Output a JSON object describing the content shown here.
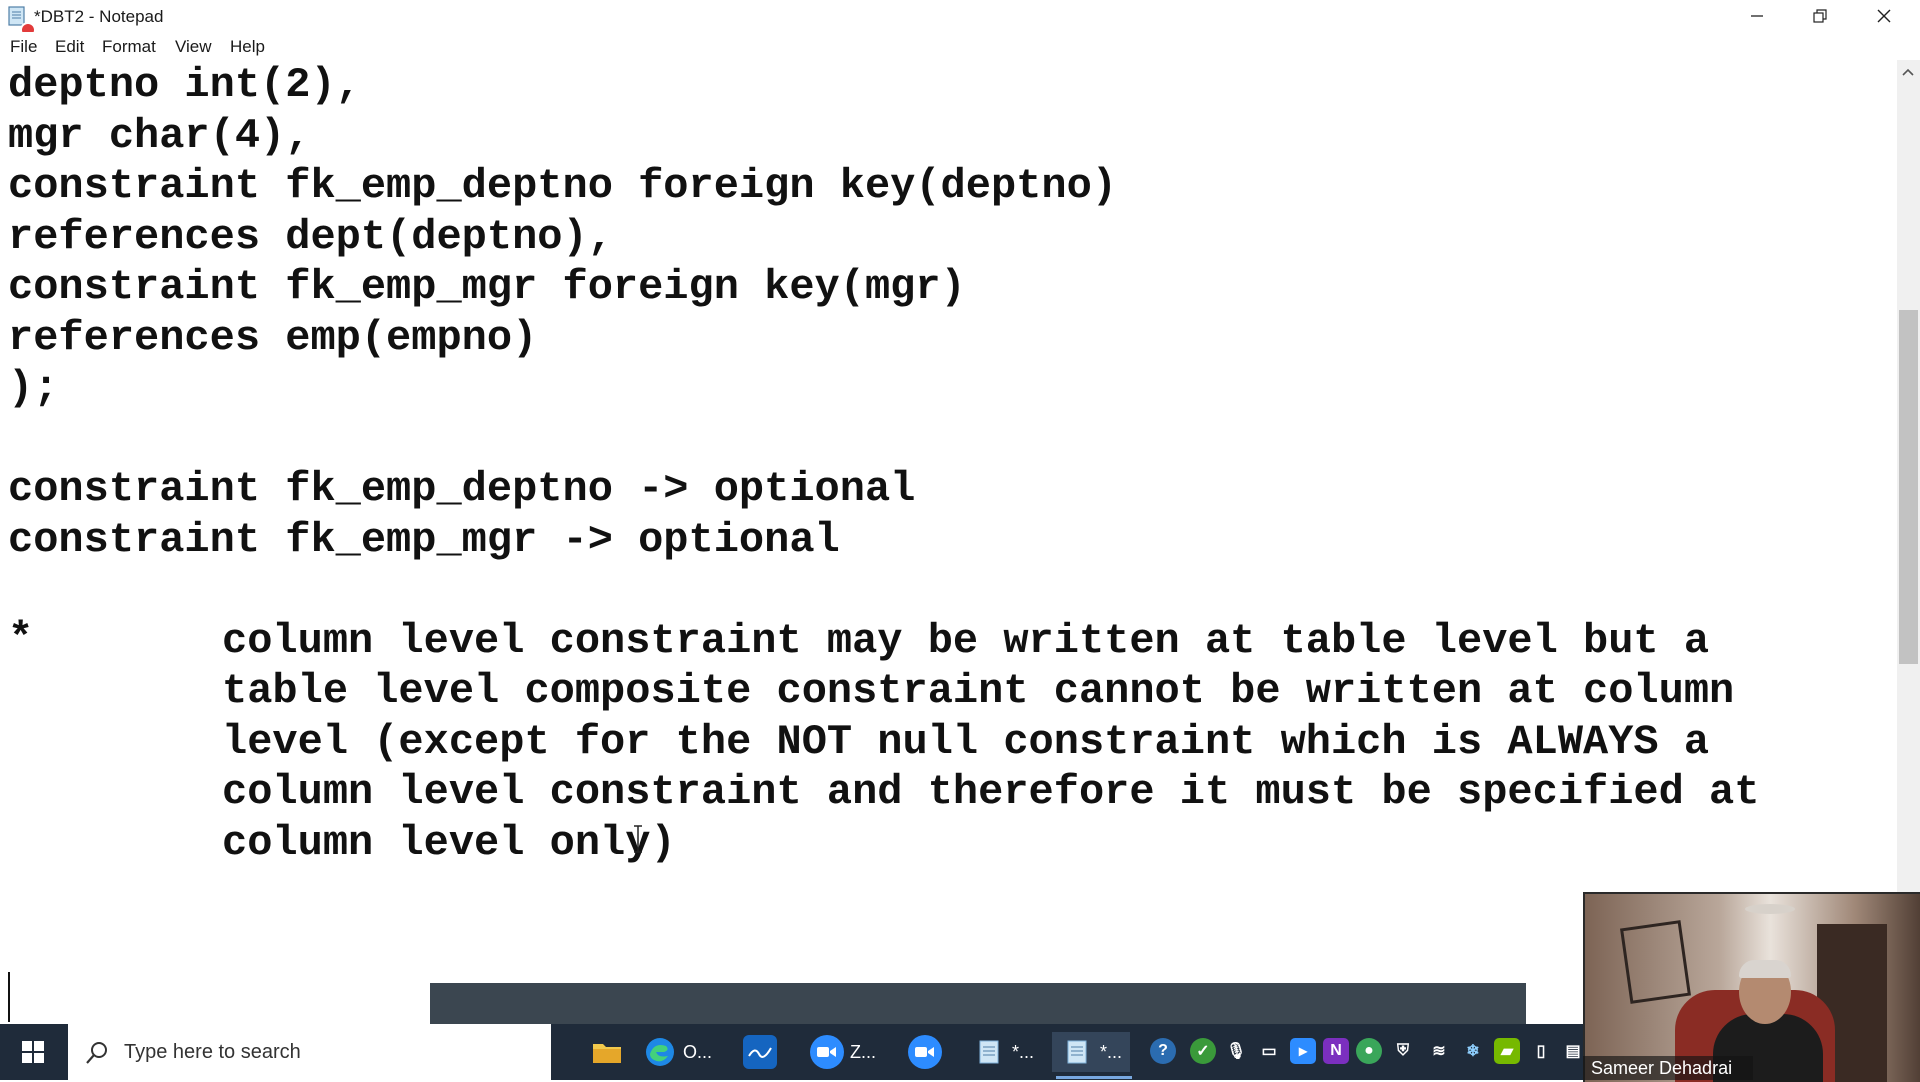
{
  "window": {
    "title": "*DBT2 - Notepad",
    "controls": [
      "minimize",
      "restore",
      "close"
    ]
  },
  "menu": [
    "File",
    "Edit",
    "Format",
    "View",
    "Help"
  ],
  "editor": {
    "lines": [
      "deptno int(2),",
      "mgr char(4),",
      "constraint fk_emp_deptno foreign key(deptno)",
      "references dept(deptno),",
      "constraint fk_emp_mgr foreign key(mgr)",
      "references emp(empno)",
      ");",
      "",
      "constraint fk_emp_deptno -> optional",
      "constraint fk_emp_mgr -> optional",
      "",
      "column level constraint may be written at table level but a",
      "table level composite constraint cannot be written at column",
      "level (except for the NOT null constraint which is ALWAYS a",
      "column level constraint and therefore it must be specified at",
      "column level only)"
    ],
    "bullet": "*"
  },
  "taskbar": {
    "search_placeholder": "Type here to search",
    "items": [
      {
        "name": "file-explorer",
        "label": ""
      },
      {
        "name": "edge",
        "label": "O..."
      },
      {
        "name": "whiteboard",
        "label": ""
      },
      {
        "name": "zoom-meeting",
        "label": "Z..."
      },
      {
        "name": "zoom",
        "label": ""
      },
      {
        "name": "notepad-1",
        "label": "*..."
      },
      {
        "name": "notepad-2",
        "label": "*..."
      }
    ]
  },
  "video": {
    "participant_name": "Sameer Dehadrai"
  },
  "colors": {
    "taskbar": "#1f2b3a",
    "text": "#111111",
    "record": "#e23b3b"
  }
}
